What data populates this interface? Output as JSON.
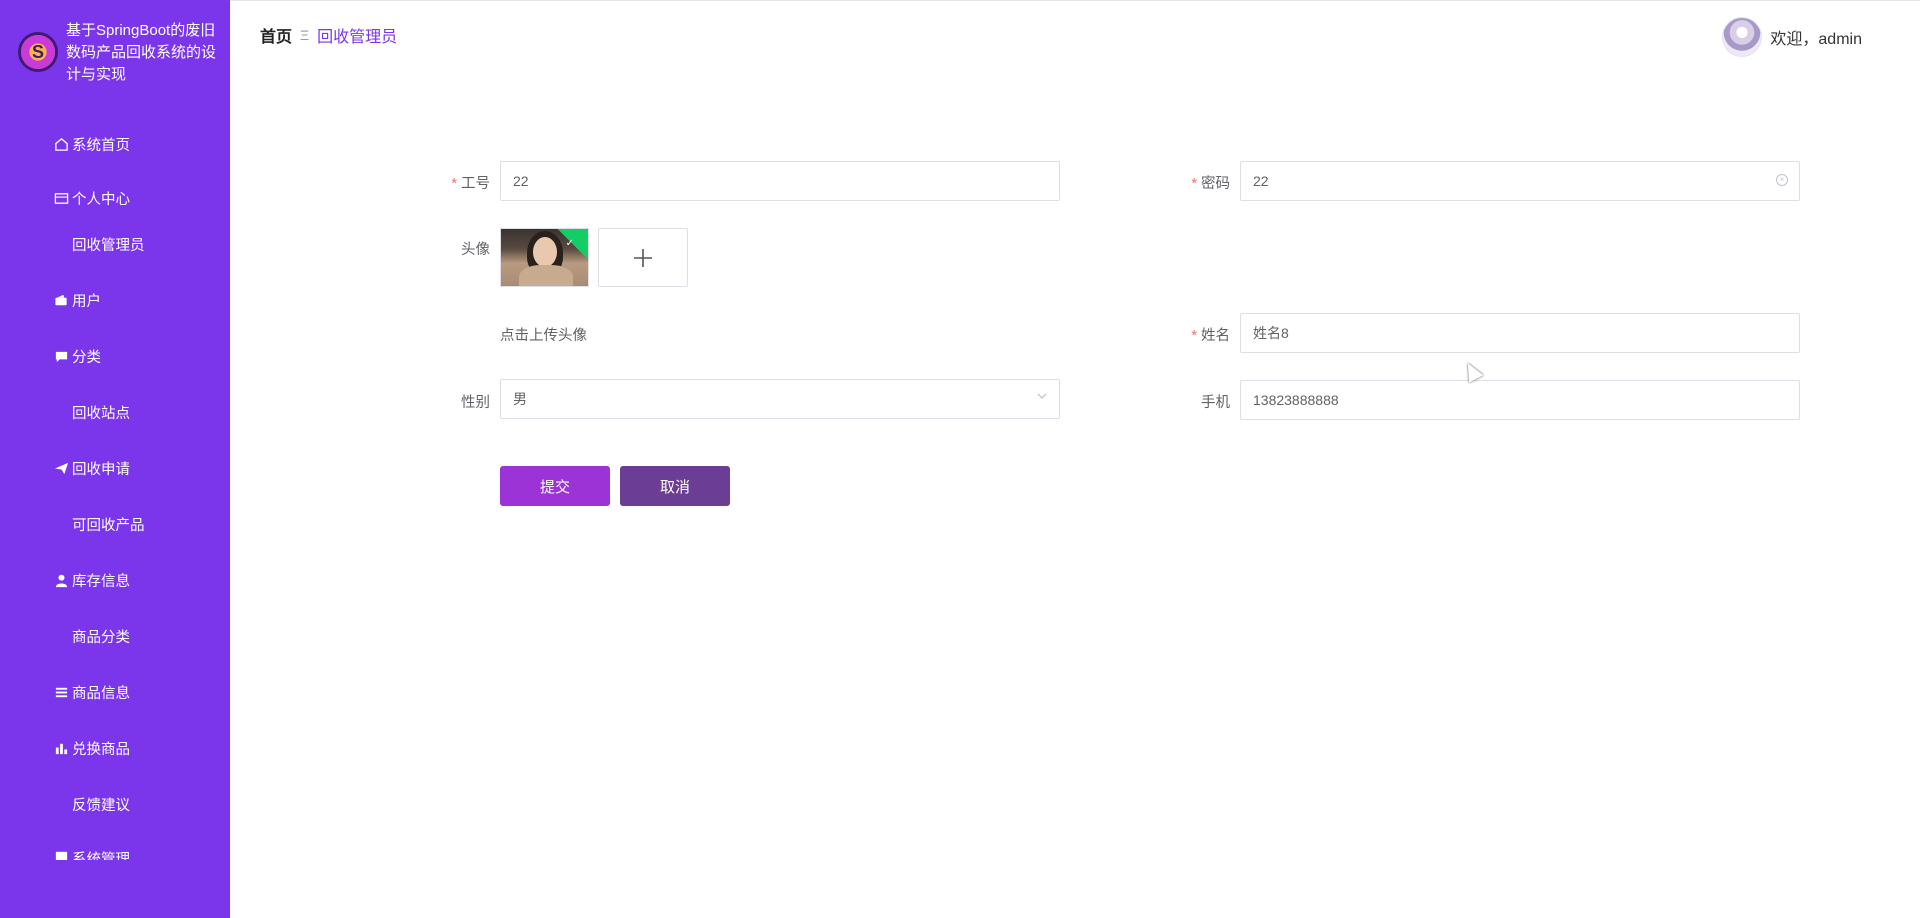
{
  "sidebar": {
    "brand_title": "基于SpringBoot的废旧数码产品回收系统的设计与实现",
    "items": [
      {
        "label": "系统首页",
        "icon": "home-icon"
      },
      {
        "label": "个人中心",
        "icon": "id-card-icon"
      },
      {
        "label": "回收管理员",
        "icon": "grid-icon"
      },
      {
        "label": "用户",
        "icon": "wallet-icon"
      },
      {
        "label": "分类",
        "icon": "chat-icon"
      },
      {
        "label": "回收站点",
        "icon": "grid-icon"
      },
      {
        "label": "回收申请",
        "icon": "send-icon"
      },
      {
        "label": "可回收产品",
        "icon": "grid-icon"
      },
      {
        "label": "库存信息",
        "icon": "user-icon"
      },
      {
        "label": "商品分类",
        "icon": "grid-icon"
      },
      {
        "label": "商品信息",
        "icon": "list-icon"
      },
      {
        "label": "兑换商品",
        "icon": "bar-chart-icon"
      },
      {
        "label": "反馈建议",
        "icon": "grid-icon"
      },
      {
        "label": "系统管理",
        "icon": "grid-icon"
      }
    ]
  },
  "header": {
    "breadcrumb_home": "首页",
    "breadcrumb_sep": "Ξ",
    "breadcrumb_current": "回收管理员",
    "welcome": "欢迎，admin"
  },
  "form": {
    "gonghao": {
      "label": "工号",
      "value": "22",
      "required": true
    },
    "mima": {
      "label": "密码",
      "value": "22",
      "required": true
    },
    "touxiang": {
      "label": "头像",
      "tip": "点击上传头像"
    },
    "xingming": {
      "label": "姓名",
      "value": "姓名8",
      "required": true
    },
    "xingbie": {
      "label": "性别",
      "value": "男"
    },
    "shouji": {
      "label": "手机",
      "value": "13823888888"
    },
    "submit_label": "提交",
    "cancel_label": "取消"
  },
  "colors": {
    "sidebar_bg": "#7b35ea",
    "accent": "#7b35ea",
    "submit_bg": "#9b33d6",
    "cancel_bg": "#6b3d95",
    "required": "#f56c6c",
    "upload_success": "#13ce66"
  }
}
